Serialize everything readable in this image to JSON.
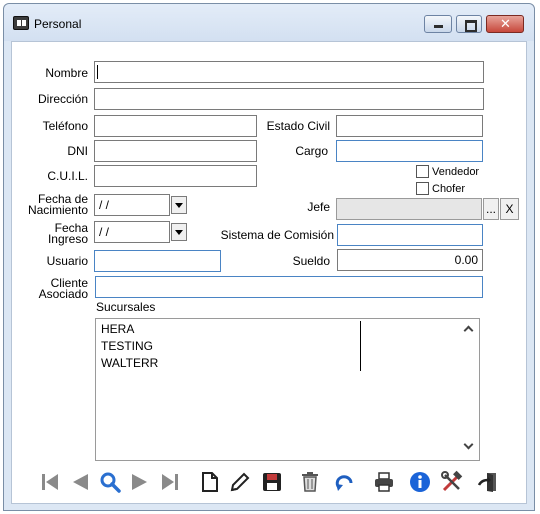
{
  "window": {
    "title": "Personal"
  },
  "labels": {
    "nombre": "Nombre",
    "direccion": "Dirección",
    "telefono": "Teléfono",
    "estado_civil": "Estado Civil",
    "dni": "DNI",
    "cargo": "Cargo",
    "cuil": "C.U.I.L.",
    "vendedor": "Vendedor",
    "chofer": "Chofer",
    "fecha_nac_1": "Fecha de",
    "fecha_nac_2": "Nacimiento",
    "jefe": "Jefe",
    "fecha_ing_1": "Fecha",
    "fecha_ing_2": "Ingreso",
    "sistema_comision": "Sistema de Comisión",
    "usuario": "Usuario",
    "sueldo": "Sueldo",
    "cliente_1": "Cliente",
    "cliente_2": "Asociado",
    "sucursales": "Sucursales"
  },
  "fields": {
    "nombre": "",
    "direccion": "",
    "telefono": "",
    "estado_civil": "",
    "dni": "",
    "cargo": "",
    "cuil": "",
    "fecha_nacimiento": " /  /",
    "jefe": "",
    "fecha_ingreso": " /  /",
    "sistema_comision": "",
    "usuario": "",
    "sueldo": "0.00",
    "cliente_asociado": ""
  },
  "jefe_buttons": {
    "browse": "...",
    "clear": "X"
  },
  "checkboxes": {
    "vendedor": false,
    "chofer": false
  },
  "sucursales": [
    "HERA",
    "TESTING",
    "WALTERR"
  ],
  "toolbar": [
    "first-record-icon",
    "previous-record-icon",
    "search-icon",
    "next-record-icon",
    "last-record-icon",
    "new-document-icon",
    "edit-pencil-icon",
    "save-disk-icon",
    "delete-trash-icon",
    "undo-icon",
    "print-icon",
    "info-icon",
    "tools-icon",
    "exit-door-icon"
  ]
}
